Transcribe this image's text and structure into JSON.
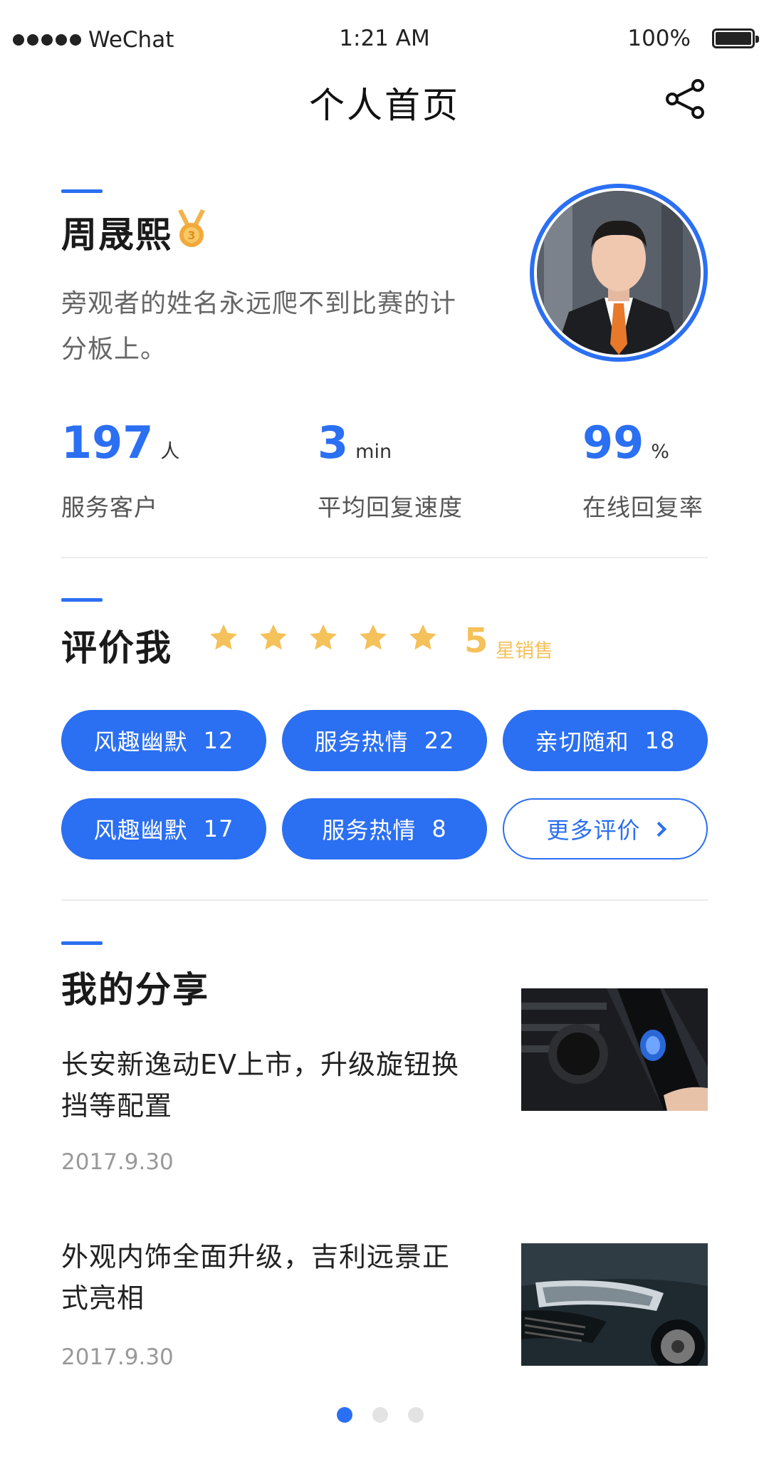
{
  "status_bar": {
    "carrier": "WeChat",
    "time": "1:21 AM",
    "battery": "100%"
  },
  "nav": {
    "title": "个人首页",
    "share_icon": "share-icon"
  },
  "profile": {
    "name": "周晟熙",
    "medal_icon": "medal-icon",
    "bio": "旁观者的姓名永远爬不到比赛的计分板上。"
  },
  "stats": [
    {
      "value": "197",
      "unit": "人",
      "label": "服务客户"
    },
    {
      "value": "3",
      "unit": "min",
      "label": "平均回复速度"
    },
    {
      "value": "99",
      "unit": "%",
      "label": "在线回复率"
    }
  ],
  "rating": {
    "title": "评价我",
    "stars": 5,
    "score": "5",
    "suffix": "星销售",
    "star_color": "#f5c15a"
  },
  "tags": [
    {
      "label": "风趣幽默",
      "count": "12"
    },
    {
      "label": "服务热情",
      "count": "22"
    },
    {
      "label": "亲切随和",
      "count": "18"
    },
    {
      "label": "风趣幽默",
      "count": "17"
    },
    {
      "label": "服务热情",
      "count": "8"
    }
  ],
  "more_reviews": "更多评价",
  "shares": {
    "title": "我的分享",
    "posts": [
      {
        "title": "长安新逸动EV上市，升级旋钮换挡等配置",
        "date": "2017.9.30"
      },
      {
        "title": "外观内饰全面升级，吉利远景正式亮相",
        "date": "2017.9.30"
      }
    ]
  },
  "pager": {
    "count": 3,
    "active": 1
  },
  "colors": {
    "accent": "#2b6ff2",
    "star": "#f5c15a"
  }
}
